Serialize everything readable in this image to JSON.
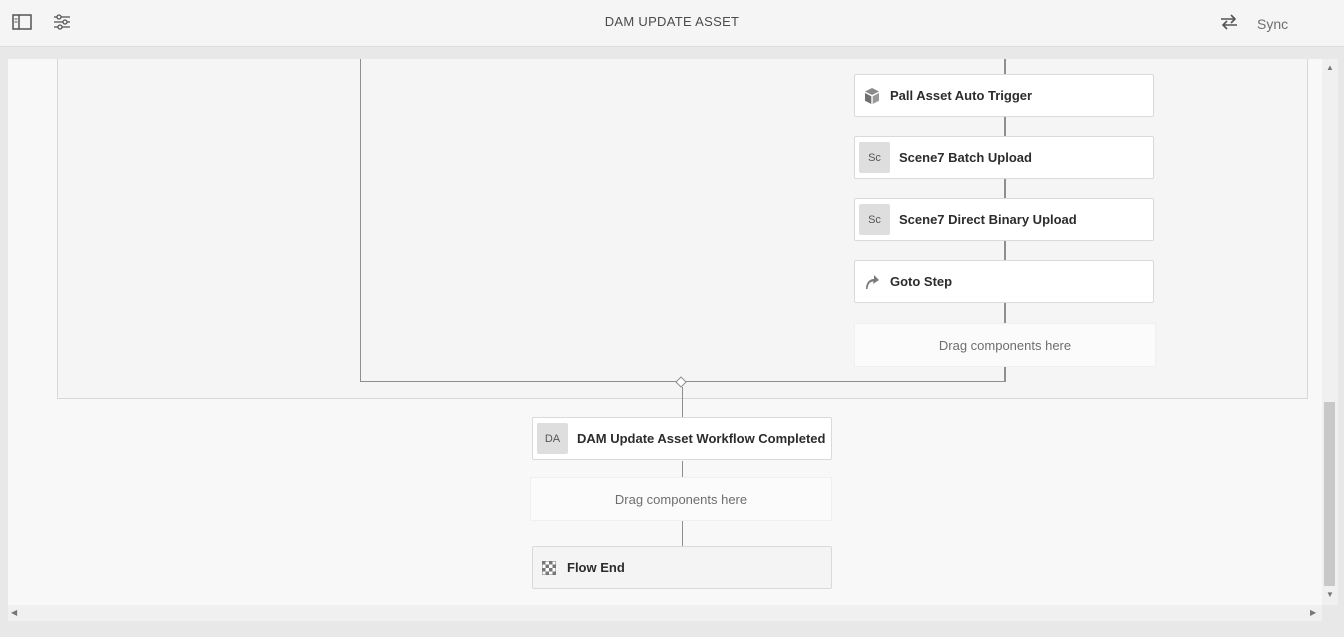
{
  "header": {
    "title": "DAM UPDATE ASSET",
    "sync_label": "Sync"
  },
  "icons": {
    "toggle_side_panel": "panel-left-icon",
    "page_info": "sliders-icon",
    "sync": "swap-arrows-icon",
    "step_generic": "cube-stack-icon",
    "goto": "arrow-up-right-icon",
    "flow_end": "checkered-flag-icon"
  },
  "branch_steps": [
    {
      "abbr": "",
      "label": "Pall Asset Auto Trigger"
    },
    {
      "abbr": "Sc",
      "label": "Scene7 Batch Upload"
    },
    {
      "abbr": "Sc",
      "label": "Scene7 Direct Binary Upload"
    },
    {
      "abbr": "",
      "label": "Goto Step"
    }
  ],
  "dropzones": {
    "branch": "Drag components here",
    "main": "Drag components here"
  },
  "main_steps": {
    "completed": {
      "abbr": "DA",
      "label": "DAM Update Asset Workflow Completed"
    },
    "flow_end": {
      "label": "Flow End"
    }
  },
  "colors": {
    "connector": "#8f8f8f",
    "step_bg": "#ffffff",
    "canvas_bg": "#f8f8f8"
  }
}
